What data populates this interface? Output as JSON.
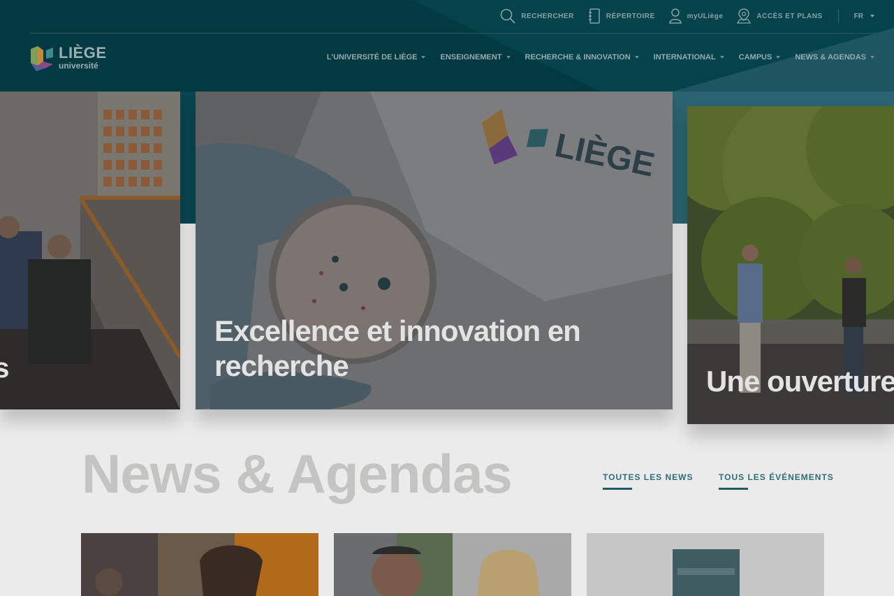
{
  "utility": {
    "search_label": "RECHERCHER",
    "directory_label": "RÉPERTOIRE",
    "myuliege_label": "myULiège",
    "access_label": "ACCÈS ET PLANS",
    "language": "FR"
  },
  "logo": {
    "main": "LIÈGE",
    "sub": "université"
  },
  "nav": [
    {
      "label": "L’UNIVERSITÉ DE LIÈGE"
    },
    {
      "label": "ENSEIGNEMENT"
    },
    {
      "label": "RECHERCHE & INNOVATION"
    },
    {
      "label": "INTERNATIONAL"
    },
    {
      "label": "CAMPUS"
    },
    {
      "label": "NEWS & AGENDAS"
    }
  ],
  "carousel": {
    "left_title": "es",
    "center_title": "Excellence et innovation en recherche",
    "right_title": "Une ouverture"
  },
  "news": {
    "title": "News & Agendas",
    "all_news": "TOUTES LES NEWS",
    "all_events": "TOUS LES ÉVÉNEMENTS"
  },
  "colors": {
    "header": "#033a42",
    "accent": "#1f5a65"
  }
}
